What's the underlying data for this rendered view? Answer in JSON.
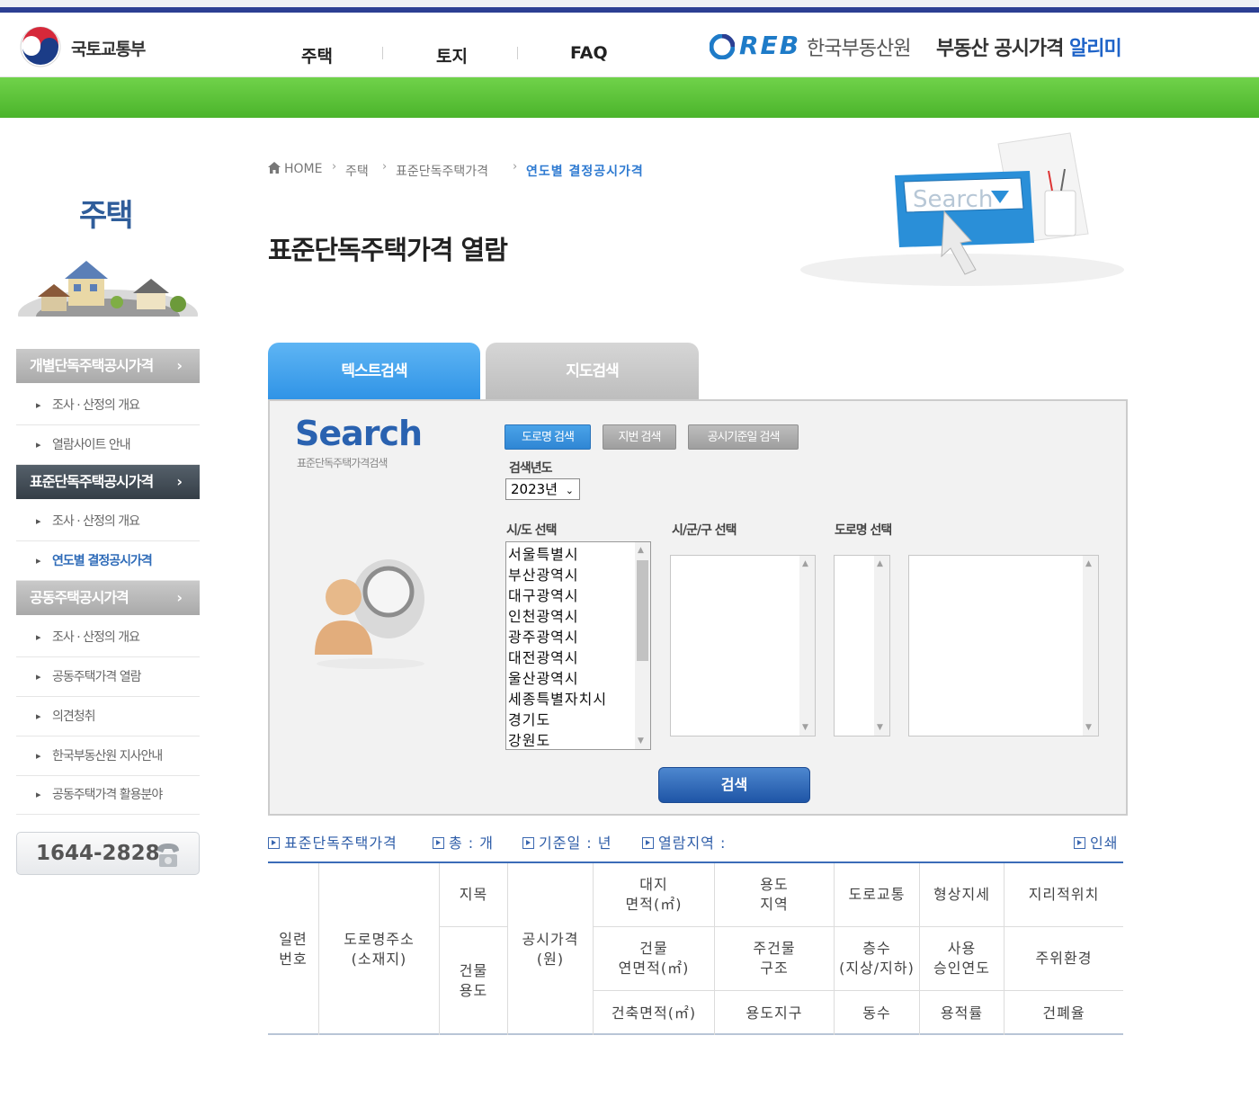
{
  "header": {
    "ministry": "국토교통부",
    "nav": [
      "주택",
      "토지",
      "FAQ"
    ],
    "reb_word": "REB",
    "reb_org": "한국부동산원",
    "service_title": "부동산 공시가격",
    "service_title_highlight": "알리미"
  },
  "sidebar": {
    "title": "주택",
    "sections": [
      {
        "label": "개별단독주택공시가격",
        "items": [
          "조사 · 산정의 개요",
          "열람사이트 안내"
        ]
      },
      {
        "label": "표준단독주택공시가격",
        "items": [
          "조사 · 산정의 개요",
          "연도별 결정공시가격"
        ]
      },
      {
        "label": "공동주택공시가격",
        "items": [
          "조사 · 산정의 개요",
          "공동주택가격 열람",
          "의견청취",
          "한국부동산원 지사안내",
          "공동주택가격 활용분야"
        ]
      }
    ],
    "phone": "1644-2828"
  },
  "breadcrumb": [
    "HOME",
    "주택",
    "표준단독주택가격",
    "연도별 결정공시가격"
  ],
  "page_title": "표준단독주택가격 열람",
  "illustration_text": "Search",
  "tabs": [
    "텍스트검색",
    "지도검색"
  ],
  "search": {
    "word": "Search",
    "subtitle": "표준단독주택가격검색",
    "buttons": [
      "도로명 검색",
      "지번 검색",
      "공시기준일 검색"
    ],
    "year_label": "검색년도",
    "year_value": "2023년",
    "sido_label": "시/도 선택",
    "sigungu_label": "시/군/구 선택",
    "road_label": "도로명 선택",
    "sido_options": [
      "서울특별시",
      "부산광역시",
      "대구광역시",
      "인천광역시",
      "광주광역시",
      "대전광역시",
      "울산광역시",
      "세종특별자치시",
      "경기도",
      "강원도"
    ],
    "submit": "검색"
  },
  "info": {
    "category": "표준단독주택가격",
    "total": "총 : 개",
    "base_date": "기준일 : 년",
    "region": "열람지역 :",
    "print": "인쇄"
  },
  "table": {
    "serial": "일련\n번호",
    "address": "도로명주소\n(소재지)",
    "jimok": "지목",
    "use": "건물\n용도",
    "price": "공시가격\n(원)",
    "land_area": "대지\n면적(㎡)",
    "zone": "용도\n지역",
    "road": "도로교통",
    "shape": "형상지세",
    "location": "지리적위치",
    "floor_area": "건물\n연면적(㎡)",
    "structure": "주건물\n구조",
    "floors": "층수\n(지상/지하)",
    "approval": "사용\n승인연도",
    "environment": "주위환경",
    "build_area": "건축면적(㎡)",
    "district": "용도지구",
    "buildings": "동수",
    "far": "용적률",
    "bcr": "건폐율"
  }
}
